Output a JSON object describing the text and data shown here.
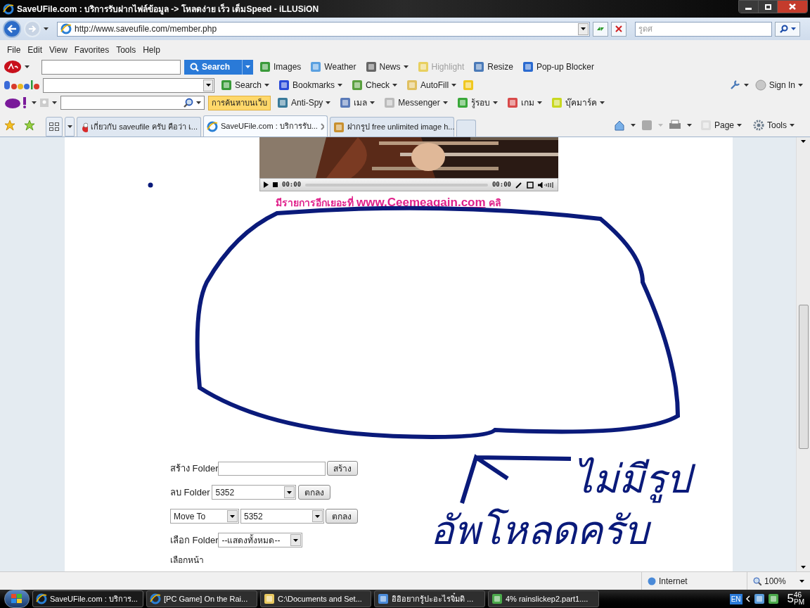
{
  "window": {
    "title": "SaveUFile.com : บริการรับฝากไฟล์ข้อมูล -> โหลดง่าย เร็ว เต็มSpeed - iLLUSiON"
  },
  "address_bar": {
    "url": "http://www.saveufile.com/member.php"
  },
  "search_box": {
    "placeholder": "รูดศ"
  },
  "menu": [
    "File",
    "Edit",
    "View",
    "Favorites",
    "Tools",
    "Help"
  ],
  "ask_toolbar": {
    "search_button": "Search",
    "items": [
      {
        "label": "Images",
        "disabled": false
      },
      {
        "label": "Weather",
        "disabled": false
      },
      {
        "label": "News",
        "disabled": false
      },
      {
        "label": "Highlight",
        "disabled": true
      },
      {
        "label": "Resize",
        "disabled": false
      },
      {
        "label": "Pop-up Blocker",
        "disabled": false
      }
    ]
  },
  "google_toolbar": {
    "items": [
      "Search",
      "Bookmarks",
      "Check",
      "AutoFill"
    ],
    "sign_in": "Sign In"
  },
  "yahoo_toolbar": {
    "search_button": "การค้นหาบนเว็บ",
    "items": [
      "Anti-Spy",
      "เมล",
      "Messenger",
      "รู้รอบ",
      "เกม",
      "บุ๊คมาร์ค"
    ]
  },
  "tabs": [
    {
      "label": "เกี่ยวกับ saveufile ครับ คือว่า เ...",
      "selected": false
    },
    {
      "label": "SaveUFile.com : บริการรับ...",
      "selected": true
    },
    {
      "label": "ฝากรูป free unlimited image h...",
      "selected": false
    }
  ],
  "command_bar": [
    "Page",
    "Tools"
  ],
  "video_player": {
    "elapsed": "00:00",
    "total": "00:00"
  },
  "promo": {
    "text": "มีรายการอีกเยอะที่",
    "link": "www.Ceemeagain.com",
    "tail": "คลิ"
  },
  "folder_form": {
    "create": {
      "label": "สร้าง Folder",
      "button": "สร้าง"
    },
    "delete": {
      "label": "ลบ Folder",
      "value": "5352",
      "button": "ตกลง"
    },
    "move": {
      "value": "Move To",
      "target": "5352",
      "button": "ตกลง"
    },
    "select": {
      "label": "เลือก Folder",
      "value": "--แสดงทั้งหมด--"
    },
    "page_label": "เลือกหน้า"
  },
  "annotation": [
    "ไม่มีรูป",
    "อัพโหลดครับ"
  ],
  "status_bar": {
    "zone": "Internet",
    "zoom": "100%"
  },
  "taskbar": [
    {
      "label": "SaveUFile.com : บริการ...",
      "selected": true
    },
    {
      "label": "[PC Game] On the Rai...",
      "selected": false
    },
    {
      "label": "C:\\Documents and Set...",
      "selected": false
    },
    {
      "label": "อิอิอยากรู้ปะอะไรจิ๋มดิ ...",
      "selected": false
    },
    {
      "label": "4% rainslickep2.part1....",
      "selected": false
    }
  ],
  "tray": {
    "language": "EN",
    "hour": "5",
    "minutes": "46",
    "period": "PM"
  }
}
